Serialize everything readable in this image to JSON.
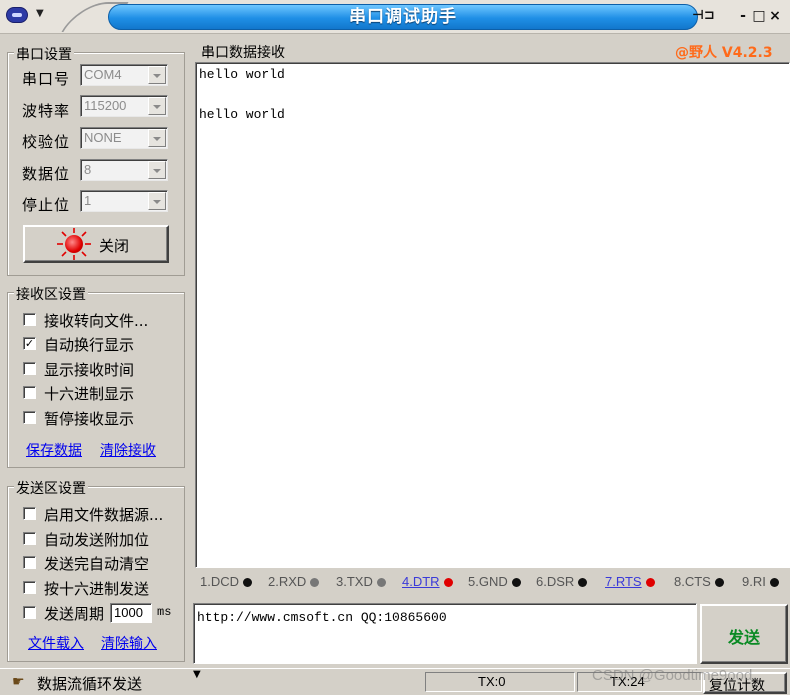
{
  "window": {
    "title": "串口调试助手",
    "buttons": {
      "pin": "⊣⊐",
      "minimize": "-",
      "maximize": "□",
      "close": "×"
    }
  },
  "serial_settings": {
    "legend": "串口设置",
    "port_label": "串口号",
    "port_value": "COM4",
    "baud_label": "波特率",
    "baud_value": "115200",
    "parity_label": "校验位",
    "parity_value": "NONE",
    "databits_label": "数据位",
    "databits_value": "8",
    "stopbits_label": "停止位",
    "stopbits_value": "1",
    "close_button": "关闭",
    "led_color": "#e00000"
  },
  "receive_settings": {
    "legend": "接收区设置",
    "options": [
      {
        "label": "接收转向文件...",
        "checked": false
      },
      {
        "label": "自动换行显示",
        "checked": true
      },
      {
        "label": "显示接收时间",
        "checked": false
      },
      {
        "label": "十六进制显示",
        "checked": false
      },
      {
        "label": "暂停接收显示",
        "checked": false
      }
    ],
    "save_link": "保存数据",
    "clear_link": "清除接收"
  },
  "send_settings": {
    "legend": "发送区设置",
    "options": [
      {
        "label": "启用文件数据源...",
        "checked": false
      },
      {
        "label": "自动发送附加位",
        "checked": false
      },
      {
        "label": "发送完自动清空",
        "checked": false
      },
      {
        "label": "按十六进制发送",
        "checked": false
      },
      {
        "label": "发送周期",
        "checked": false
      }
    ],
    "period_value": "1000",
    "period_unit": "ms",
    "load_file_link": "文件载入",
    "clear_input_link": "清除输入"
  },
  "receive_panel": {
    "legend": "串口数据接收",
    "version": "@野人 V4.2.3",
    "lines": [
      "hello world",
      "",
      "hello world"
    ]
  },
  "signals": [
    {
      "label": "1.DCD",
      "dot": "#111111",
      "link": false
    },
    {
      "label": "2.RXD",
      "dot": "#777777",
      "link": false
    },
    {
      "label": "3.TXD",
      "dot": "#777777",
      "link": false
    },
    {
      "label": "4.DTR",
      "dot": "#e00000",
      "link": true
    },
    {
      "label": "5.GND",
      "dot": "#111111",
      "link": false
    },
    {
      "label": "6.DSR",
      "dot": "#111111",
      "link": false
    },
    {
      "label": "7.RTS",
      "dot": "#e00000",
      "link": true
    },
    {
      "label": "8.CTS",
      "dot": "#111111",
      "link": false
    },
    {
      "label": "9.RI",
      "dot": "#111111",
      "link": false
    }
  ],
  "send_panel": {
    "text": "http://www.cmsoft.cn QQ:10865600",
    "send_button": "发送",
    "send_color": "#0a8a24"
  },
  "status_bar": {
    "loop_label": "数据流循环发送",
    "tx_label": "TX:0",
    "rx_label": "TX:24",
    "reset_button": "复位计数",
    "watermark": "CSDN @Goodtime9ood"
  }
}
